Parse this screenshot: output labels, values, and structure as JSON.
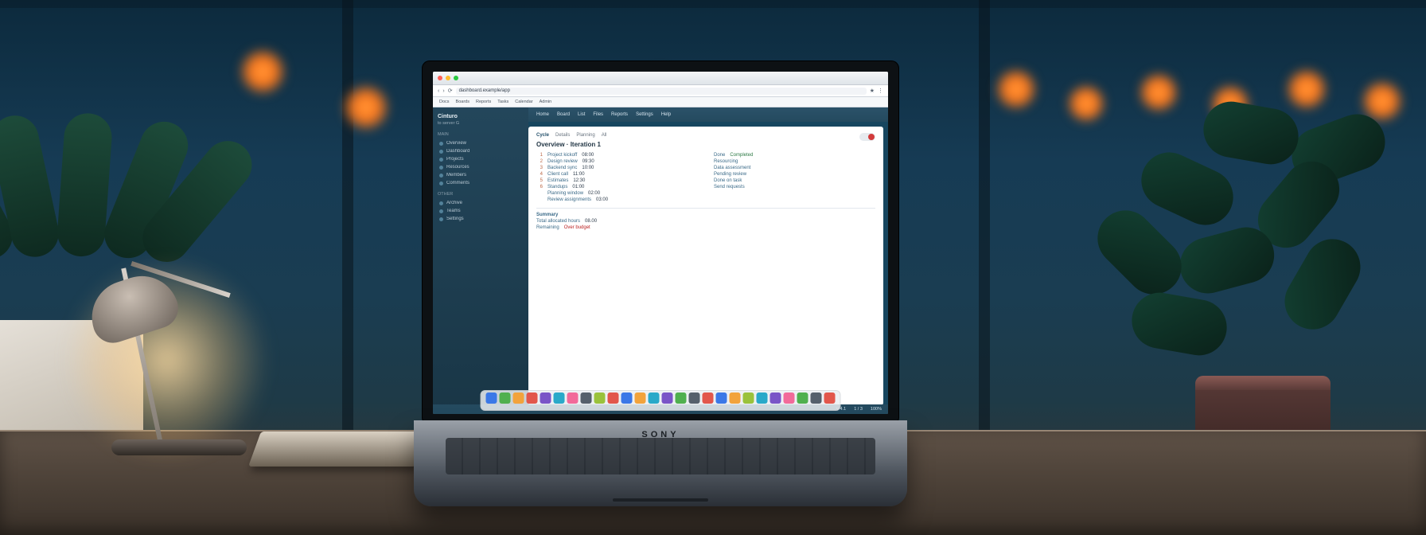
{
  "laptop_brand": "SONY",
  "browser": {
    "url": "dashboard.example/app",
    "bookmarks": [
      "Docs",
      "Boards",
      "Reports",
      "Tasks",
      "Calendar",
      "Admin"
    ]
  },
  "app": {
    "brand": "Cinturo",
    "brand_sub": "to server G",
    "topnav": [
      "Home",
      "Board",
      "List",
      "Files",
      "Reports",
      "Settings",
      "Help"
    ],
    "side_section_a": "MAIN",
    "side_section_b": "OTHER",
    "side_items_a": [
      "Overview",
      "Dashboard",
      "Projects",
      "Resources",
      "Members",
      "Comments"
    ],
    "side_items_b": [
      "Archive",
      "Teams",
      "Settings"
    ]
  },
  "panel": {
    "tabs": [
      "Cycle",
      "Details",
      "Planning",
      "All"
    ],
    "title": "Overview · Iteration 1",
    "left": [
      {
        "n": "1",
        "k": "Project kickoff",
        "v": "08:00"
      },
      {
        "n": "2",
        "k": "Design review",
        "v": "09:30"
      },
      {
        "n": "3",
        "k": "Backend sync",
        "v": "10:00"
      },
      {
        "n": "4",
        "k": "Client call",
        "v": "11:00"
      },
      {
        "n": "5",
        "k": "Estimates",
        "v": "12:30"
      },
      {
        "n": "6",
        "k": "Standups",
        "v": "01:00"
      },
      {
        "n": "",
        "k": "Planning window",
        "v": "02:00"
      },
      {
        "n": "",
        "k": "Review assignments",
        "v": "03:00"
      }
    ],
    "right": [
      {
        "k": "Done",
        "v": "Completed"
      },
      {
        "k": "Resourcing",
        "v": ""
      },
      {
        "k": "Data assessment",
        "v": ""
      },
      {
        "k": "Pending review",
        "v": ""
      },
      {
        "k": "Done on task",
        "v": ""
      },
      {
        "k": "Send requests",
        "v": ""
      }
    ],
    "footer_a": "Summary",
    "footer_b_k": "Total allocated hours",
    "footer_b_v": "08.00",
    "footer_c_k": "Remaining",
    "footer_c_v": "Over budget"
  },
  "status": {
    "a": "v 4.1",
    "b": "1 / 3",
    "c": "100%"
  },
  "dock_colors": [
    "#3b78e7",
    "#50b04f",
    "#f2a33c",
    "#e2574c",
    "#7a55c7",
    "#2aa9c9",
    "#f26a9a",
    "#55606c",
    "#9ac23c",
    "#e2574c",
    "#3b78e7",
    "#f2a33c",
    "#2aa9c9",
    "#7a55c7",
    "#50b04f",
    "#55606c",
    "#e2574c",
    "#3b78e7",
    "#f2a33c",
    "#9ac23c",
    "#2aa9c9",
    "#7a55c7",
    "#f26a9a",
    "#50b04f",
    "#55606c",
    "#e2574c"
  ]
}
